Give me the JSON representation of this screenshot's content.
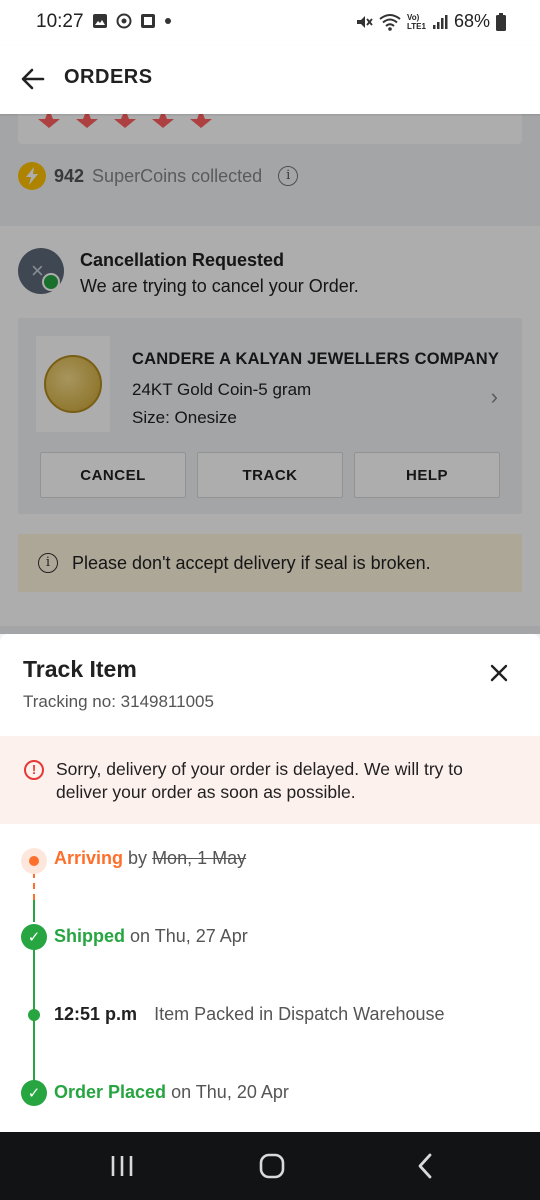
{
  "status_bar": {
    "time": "10:27",
    "battery": "68%",
    "network_label_top": "Vo)",
    "network_label_bottom": "LTE1",
    "left_icons": [
      "image-icon",
      "at-icon",
      "app-icon",
      "dot-icon"
    ],
    "right_icons": [
      "mute-icon",
      "wifi-icon",
      "signal-icon",
      "battery-icon"
    ]
  },
  "app_bar": {
    "title": "ORDERS",
    "back_icon": "arrow-left-icon"
  },
  "background": {
    "rating_stars": 5,
    "supercoins_count": "942",
    "supercoins_text": "SuperCoins collected",
    "order_status_title": "Cancellation Requested",
    "order_status_sub": "We are trying to cancel your Order.",
    "product": {
      "brand": "CANDERE A KALYAN JEWELLERS COMPANY",
      "name": "24KT Gold Coin-5 gram",
      "size": "Size: Onesize"
    },
    "actions": [
      "CANCEL",
      "TRACK",
      "HELP"
    ],
    "seal_notice": "Please don't accept delivery if seal is broken."
  },
  "sheet": {
    "title": "Track Item",
    "tracking_label": "Tracking no:",
    "tracking_number": "3149811005",
    "alert": "Sorry, delivery of your order is delayed. We will try to deliver your order as soon as possible.",
    "timeline": [
      {
        "label": "Arriving",
        "connector": "by",
        "date": "Mon, 1 May",
        "state": "pending",
        "color": "#ff6f2c"
      },
      {
        "label": "Shipped",
        "connector": "on",
        "date": "Thu, 27 Apr",
        "state": "done",
        "color": "#26a541"
      },
      {
        "time": "12:51 p.m",
        "text": "Item Packed in Dispatch Warehouse",
        "state": "sub"
      },
      {
        "label": "Order Placed",
        "connector": "on",
        "date": "Thu, 20 Apr",
        "state": "done",
        "color": "#26a541"
      }
    ]
  },
  "nav_bar": {
    "items": [
      "recents-icon",
      "home-icon",
      "back-icon"
    ]
  },
  "colors": {
    "accent_orange": "#ff6f2c",
    "success_green": "#26a541",
    "star_pink": "#ff6161",
    "alert_bg": "#fdf1ee"
  }
}
